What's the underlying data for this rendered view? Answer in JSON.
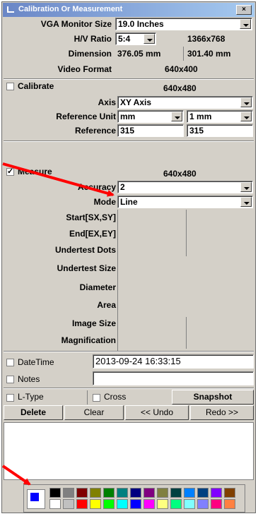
{
  "window": {
    "title": "Calibration Or Measurement",
    "close_label": "×"
  },
  "monitor": {
    "label": "VGA  Monitor Size",
    "value": "19.0 Inches"
  },
  "hv_ratio": {
    "label": "H/V Ratio",
    "value": "5:4",
    "resolution": "1366x768"
  },
  "dimension": {
    "label": "Dimension",
    "width": "376.05 mm",
    "height": "301.40 mm"
  },
  "video_format": {
    "label": "Video Format",
    "value": "640x400"
  },
  "calibrate": {
    "label": "Calibrate",
    "checked": false,
    "resolution": "640x480"
  },
  "axis": {
    "label": "Axis",
    "value": "XY Axis"
  },
  "reference_unit": {
    "label": "Reference Unit",
    "unit": "mm",
    "unit2": "mm",
    "prefix": "1"
  },
  "reference": {
    "label": "Reference",
    "x": "315",
    "y": "315"
  },
  "measure": {
    "label": "Measure",
    "checked": true,
    "resolution": "640x480"
  },
  "accuracy": {
    "label": "Accuracy",
    "value": "2"
  },
  "mode": {
    "label": "Mode",
    "value": "Line"
  },
  "results": {
    "start": "Start[SX,SY]",
    "end": "End[EX,EY]",
    "undertest_dots": "Undertest Dots",
    "undertest_size": "Undertest Size",
    "diameter": "Diameter",
    "area": "Area",
    "image_size": "Image Size",
    "magnification": "Magnification"
  },
  "datetime": {
    "label": "DateTime",
    "value": "2013-09-24  16:33:15"
  },
  "notes": {
    "label": "Notes",
    "value": ""
  },
  "options": {
    "ltype": "L-Type",
    "cross": "Cross",
    "snapshot": "Snapshot"
  },
  "actions": {
    "delete": "Delete",
    "clear": "Clear",
    "undo": "<< Undo",
    "redo": "Redo >>"
  },
  "palette": {
    "current": "#0000ff",
    "row1": [
      "#000000",
      "#808080",
      "#800000",
      "#808000",
      "#008000",
      "#008080",
      "#000080",
      "#800080",
      "#808040",
      "#004040",
      "#0080ff",
      "#004080",
      "#8000ff",
      "#804000"
    ],
    "row2": [
      "#ffffff",
      "#c0c0c0",
      "#ff0000",
      "#ffff00",
      "#00ff00",
      "#00ffff",
      "#0000ff",
      "#ff00ff",
      "#ffff80",
      "#00ff80",
      "#80ffff",
      "#8080ff",
      "#ff0080",
      "#ff8040"
    ]
  },
  "annotations": {
    "arrow_color": "#ff0000"
  }
}
